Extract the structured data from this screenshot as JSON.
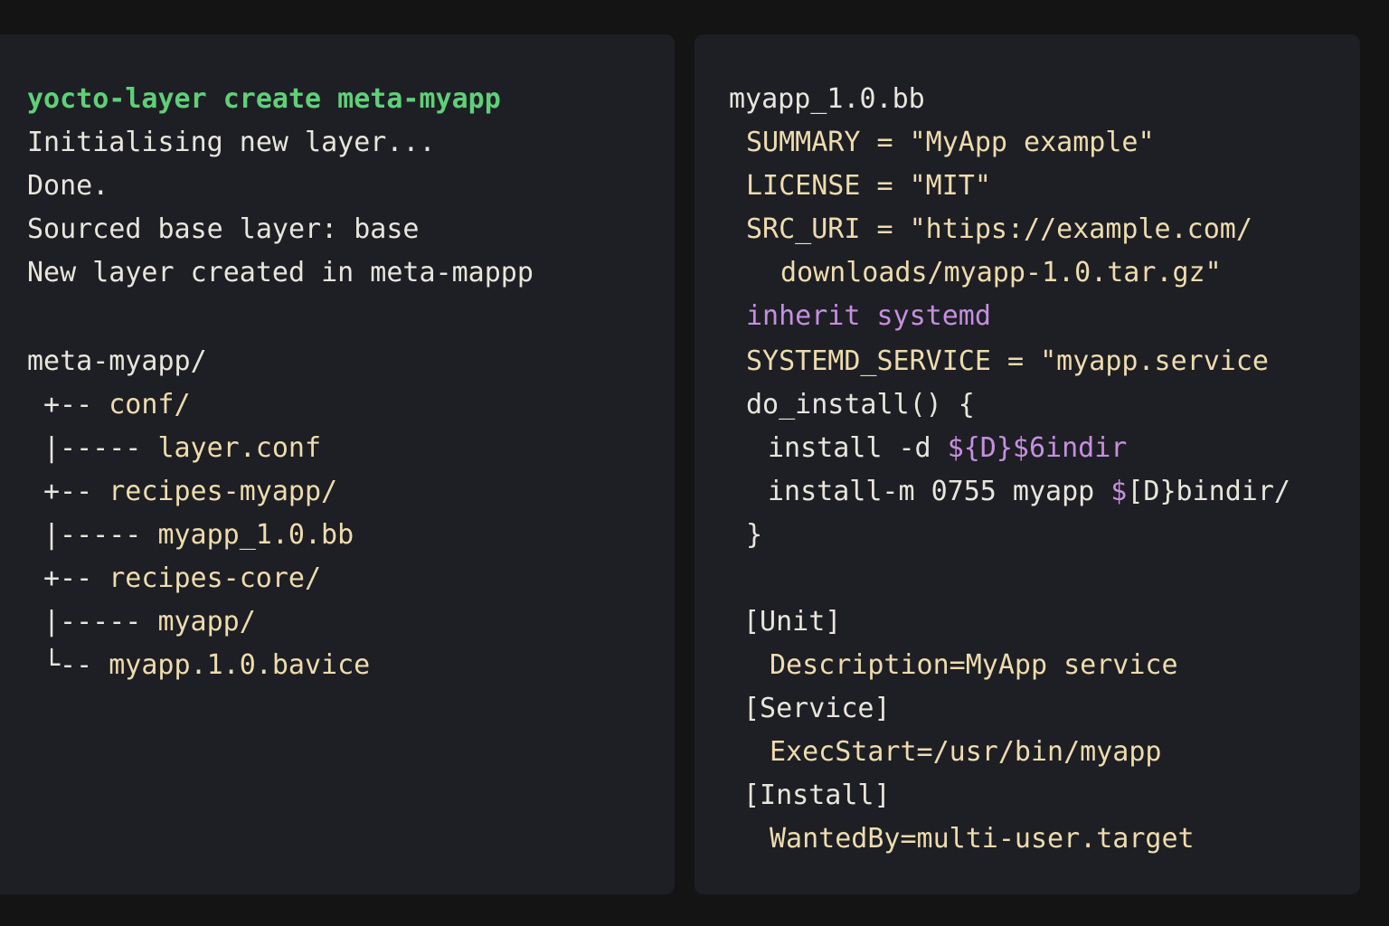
{
  "colors": {
    "background": "#141415",
    "pane": "#1e1f24",
    "command": "#5fd078",
    "text": "#e8e6dc",
    "string": "#eedcae",
    "keyword": "#c68fe0"
  },
  "terminal": {
    "command": "yocto-layer create meta-myapp",
    "output": [
      "Initialising new layer...",
      "Done.",
      "Sourced base layer: base",
      "New layer created in meta-mappp"
    ],
    "tree": {
      "root": "meta-myapp/",
      "entries": [
        {
          "branch": "+-- ",
          "name": "conf/"
        },
        {
          "branch": "|----- ",
          "name": "layer.conf"
        },
        {
          "branch": "+-- ",
          "name": "recipes-myapp/"
        },
        {
          "branch": "|----- ",
          "name": "myapp_1.0.bb"
        },
        {
          "branch": "+-- ",
          "name": "recipes-core/"
        },
        {
          "branch": "|----- ",
          "name": "myapp/"
        },
        {
          "branch": "└-- ",
          "name": "myapp.1.0.bavice"
        }
      ]
    }
  },
  "editor": {
    "filename": "myapp_1.0.bb",
    "summary_line": "SUMMARY = \"MyApp example\"",
    "license_line": "LICENSE = \"MIT\"",
    "src_uri_line": "SRC_URI = \"htips://example.com/",
    "src_uri_cont": "downloads/myapp-1.0.tar.gz\"",
    "inherit_kw": "inherit",
    "inherit_arg": "systemd",
    "systemd_service_line": "SYSTEMD_SERVICE = \"myapp.service",
    "do_install_open": "do_install() {",
    "install1_cmd": "install -d ",
    "install1_var": "${D}$6indir",
    "install2_cmd": "install-m 0755 myapp ",
    "install2_var": "$",
    "install2_rest": "[D}bindir/",
    "close_brace": "}",
    "unit_header": "[Unit]",
    "unit_desc": "Description=MyApp service",
    "service_header": "[Service]",
    "service_exec": "ExecStart=/usr/bin/myapp",
    "install_header": "[Install]",
    "install_wanted": "WantedBy=multi-user.target"
  }
}
